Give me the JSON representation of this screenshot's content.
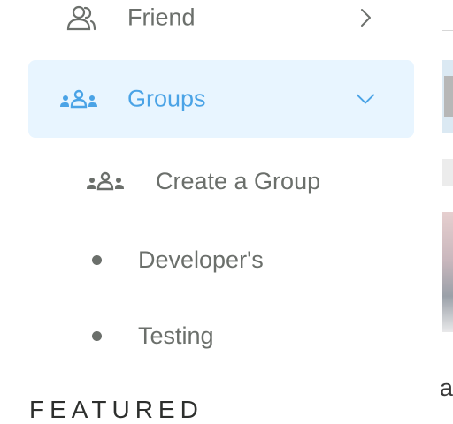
{
  "sidebar": {
    "items": [
      {
        "label": "Friend",
        "icon": "friend-icon",
        "chevron": "chevron-right-icon",
        "active": false
      },
      {
        "label": "Groups",
        "icon": "groups-icon",
        "chevron": "chevron-down-icon",
        "active": true
      }
    ],
    "subitems": [
      {
        "label": "Create a Group",
        "icon": "create-group-icon"
      },
      {
        "label": "Developer's",
        "icon": "bullet-icon"
      },
      {
        "label": "Testing",
        "icon": "bullet-icon"
      }
    ],
    "section_title": "FEATURED"
  },
  "edge": {
    "letter": "a"
  },
  "colors": {
    "active_bg": "#e8f5ff",
    "active_text": "#4aa3e6",
    "text": "#6b6f6b"
  }
}
